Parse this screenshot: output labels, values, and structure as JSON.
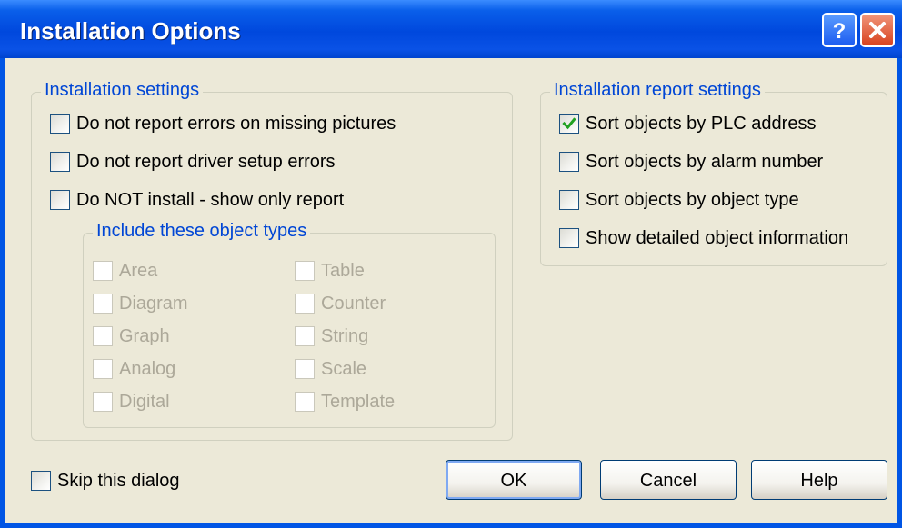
{
  "window": {
    "title": "Installation Options",
    "help_button_glyph": "?",
    "close_button_glyph": "✕"
  },
  "install_settings": {
    "legend": "Installation settings",
    "options": [
      {
        "label": "Do not report errors on missing pictures",
        "checked": false
      },
      {
        "label": "Do not report driver setup errors",
        "checked": false
      },
      {
        "label": "Do NOT install - show only report",
        "checked": false
      }
    ],
    "object_types": {
      "legend": "Include these object types",
      "enabled": false,
      "left_column": [
        "Area",
        "Diagram",
        "Graph",
        "Analog",
        "Digital"
      ],
      "right_column": [
        "Table",
        "Counter",
        "String",
        "Scale",
        "Template"
      ]
    }
  },
  "report_settings": {
    "legend": "Installation report settings",
    "options": [
      {
        "label": "Sort objects by PLC address",
        "checked": true
      },
      {
        "label": "Sort objects by alarm number",
        "checked": false
      },
      {
        "label": "Sort objects by object type",
        "checked": false
      },
      {
        "label": "Show detailed object information",
        "checked": false
      }
    ]
  },
  "footer": {
    "skip_label": "Skip this dialog",
    "skip_checked": false,
    "ok_label": "OK",
    "cancel_label": "Cancel",
    "help_label": "Help"
  },
  "colors": {
    "titlebar": "#0054e3",
    "dialog_background": "#ece9d8",
    "groupbox_legend": "#0046d5",
    "checkmark": "#21a121",
    "disabled_text": "#aca899"
  }
}
